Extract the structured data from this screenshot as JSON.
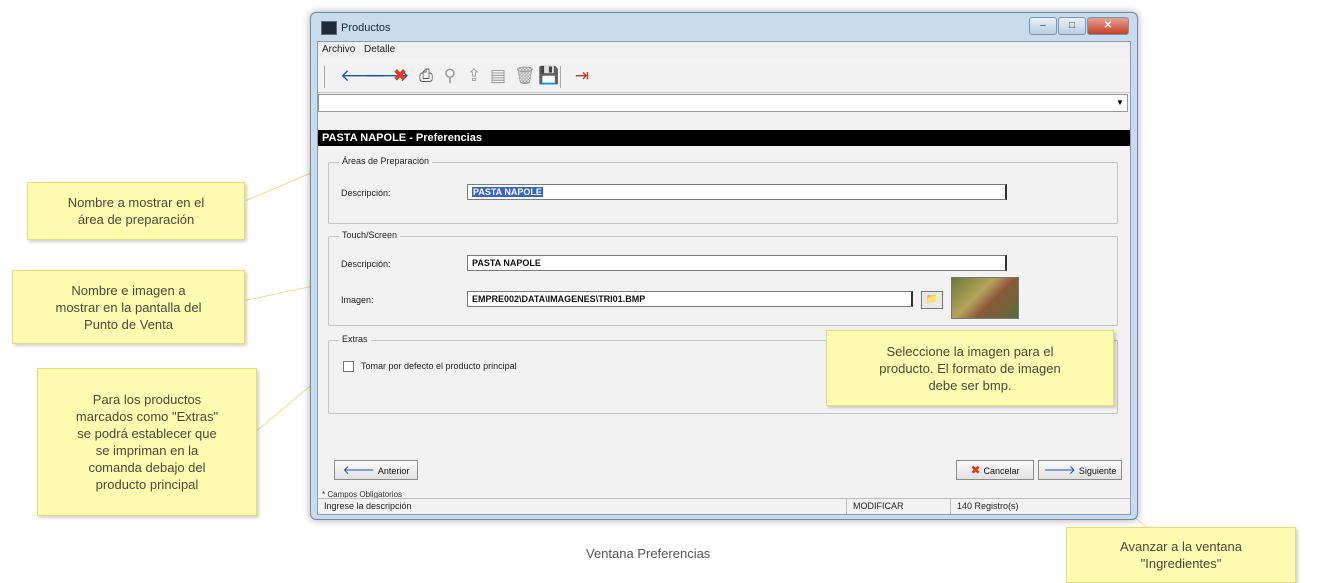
{
  "window": {
    "title": "Productos",
    "controls": {
      "minimize": "–",
      "maximize": "□",
      "close": "✕"
    }
  },
  "menu": [
    "Archivo",
    "Detalle"
  ],
  "toolbar_icons": [
    {
      "name": "back-arrow-icon",
      "glyph": "🡐",
      "color": "#1e4fb5"
    },
    {
      "name": "forward-arrow-icon",
      "glyph": "🡒",
      "color": "#1e4fb5"
    },
    {
      "name": "delete-x-icon",
      "glyph": "✖",
      "color": "#e23b1c"
    },
    {
      "name": "print-icon",
      "glyph": "⎙",
      "color": "#555555"
    },
    {
      "name": "search-icon",
      "glyph": "⚲",
      "color": "#999999"
    },
    {
      "name": "export-icon",
      "glyph": "⇪",
      "color": "#999999"
    },
    {
      "name": "report-icon",
      "glyph": "▤",
      "color": "#999999"
    },
    {
      "name": "trash-icon",
      "glyph": "🗑",
      "color": "#999999"
    },
    {
      "name": "save-icon",
      "glyph": "💾",
      "color": "#7a2a7a"
    },
    {
      "name": "exit-icon",
      "glyph": "⇥",
      "color": "#c0392b"
    }
  ],
  "section_header": "PASTA NAPOLE - Preferencias",
  "areas": {
    "legend": "Áreas de Preparación",
    "desc_label": "Descripción:",
    "desc_value": "PASTA NAPOLE"
  },
  "touch": {
    "legend": "Touch/Screen",
    "desc_label": "Descripción:",
    "desc_value": "PASTA NAPOLE",
    "img_label": "Imagen:",
    "img_value": "EMPRE002\\DATA\\IMAGENES\\TRI01.BMP"
  },
  "extras": {
    "legend": "Extras",
    "checkbox_label": "Tomar por defecto el producto principal",
    "checked": false
  },
  "buttons": {
    "back": "Anterior",
    "cancel": "Cancelar",
    "next": "Siguiente"
  },
  "required_note": "* Campos Obligatorios",
  "status": {
    "message": "Ingrese la descripción",
    "mode": "MODIFICAR",
    "records": "140 Registro(s)"
  },
  "callouts": {
    "c1": "Nombre a mostrar en el\nárea de preparación",
    "c2": "Nombre e imagen a\nmostrar en la pantalla del\nPunto de Venta",
    "c3": "Para los productos\nmarcados como \"Extras\"\nse podrá establecer que\nse impriman en la\ncomanda debajo del\nproducto principal",
    "c4": "Seleccione la imagen para el\nproducto. El formato de imagen\ndebe ser bmp.",
    "c5": "Avanzar a la ventana\n\"Ingredientes\""
  },
  "caption": "Ventana Preferencias"
}
